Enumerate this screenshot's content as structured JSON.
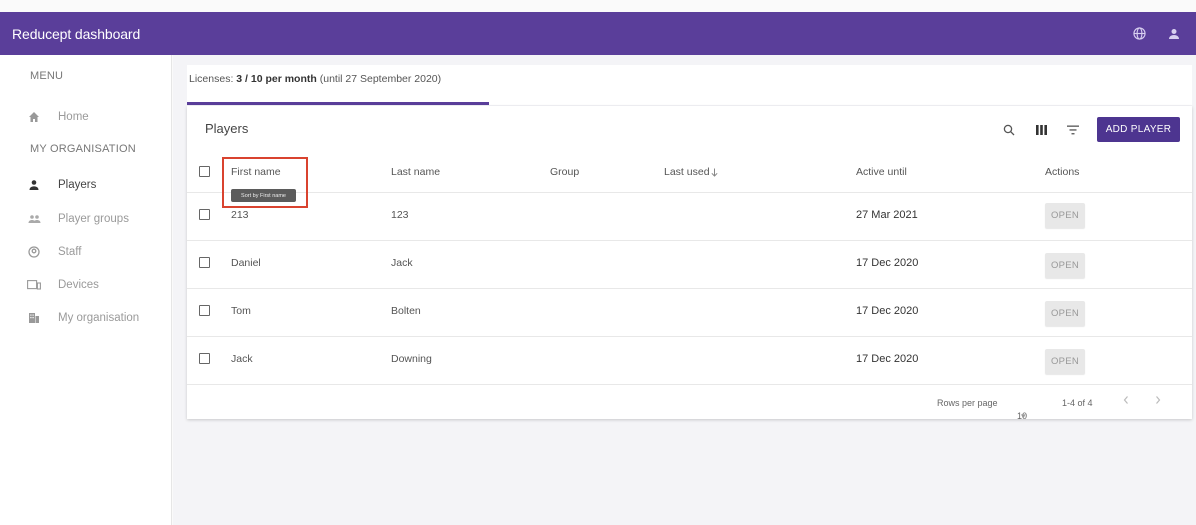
{
  "app": {
    "title": "Reducept dashboard"
  },
  "topbar_icons": [
    "globe-icon",
    "account-icon"
  ],
  "sidebar": {
    "menu_label": "MENU",
    "org_label": "MY ORGANISATION",
    "items": [
      {
        "label": "Home",
        "icon": "home-icon"
      },
      {
        "label": "Players",
        "icon": "person-icon",
        "active": true
      },
      {
        "label": "Player groups",
        "icon": "group-icon"
      },
      {
        "label": "Staff",
        "icon": "staff-icon"
      },
      {
        "label": "Devices",
        "icon": "devices-icon"
      },
      {
        "label": "My organisation",
        "icon": "building-icon"
      }
    ]
  },
  "license": {
    "prefix": "Licenses: ",
    "count": "3 / 10 per month",
    "suffix": " (until 27 September 2020)"
  },
  "table": {
    "title": "Players",
    "add_button": "ADD PLAYER",
    "columns": [
      "First name",
      "Last name",
      "Group",
      "Last used",
      "Active until",
      "Actions"
    ],
    "sort_tooltip": "Sort by First name",
    "rows": [
      {
        "first": "213",
        "last": "123",
        "group": "",
        "last_used": "",
        "active_until": "27 Mar 2021",
        "action": "OPEN"
      },
      {
        "first": "Daniel",
        "last": "Jack",
        "group": "",
        "last_used": "",
        "active_until": "17 Dec 2020",
        "action": "OPEN"
      },
      {
        "first": "Tom",
        "last": "Bolten",
        "group": "",
        "last_used": "",
        "active_until": "17 Dec 2020",
        "action": "OPEN"
      },
      {
        "first": "Jack",
        "last": "Downing",
        "group": "",
        "last_used": "",
        "active_until": "17 Dec 2020",
        "action": "OPEN"
      }
    ],
    "footer": {
      "rows_per_page_label": "Rows per page",
      "rows_per_page_value": "10",
      "range": "1-4 of 4"
    }
  },
  "colors": {
    "primary": "#5a3e9a",
    "highlight": "#d9432f"
  }
}
